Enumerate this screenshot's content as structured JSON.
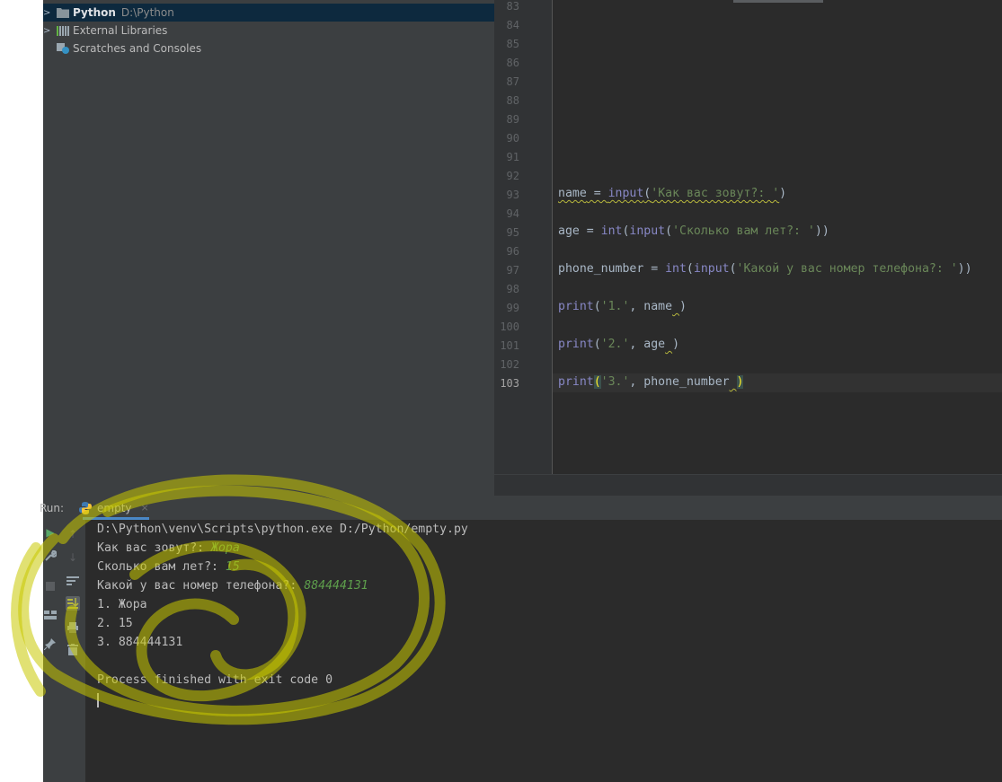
{
  "project_tree": {
    "items": [
      {
        "label": "Python",
        "path": "D:\\Python",
        "selected": true
      },
      {
        "label": "External Libraries"
      },
      {
        "label": "Scratches and Consoles"
      }
    ]
  },
  "editor": {
    "line_numbers": [
      "83",
      "84",
      "85",
      "86",
      "87",
      "88",
      "89",
      "90",
      "91",
      "92",
      "93",
      "94",
      "95",
      "96",
      "97",
      "98",
      "99",
      "100",
      "101",
      "102",
      "103"
    ],
    "current_line": "103",
    "code": {
      "l93": {
        "name": "name",
        "eq": " = ",
        "fn": "input",
        "open": "(",
        "str": "'Как вас зовут?: '",
        "close": ")"
      },
      "l95": {
        "pre": "age = ",
        "fn1": "int",
        "p1": "(",
        "fn2": "input",
        "p2": "(",
        "str": "'Сколько вам лет?: '",
        "close": "))"
      },
      "l97": {
        "pre": "phone_number = ",
        "fn1": "int",
        "p1": "(",
        "fn2": "input",
        "p2": "(",
        "str": "'Какой у вас номер телефона?: '",
        "close": "))"
      },
      "l99": {
        "fn": "print",
        "open": "(",
        "str": "'1.'",
        "mid": ", name",
        "sq": " ",
        "close": ")"
      },
      "l101": {
        "fn": "print",
        "open": "(",
        "str": "'2.'",
        "mid": ", age",
        "sq": " ",
        "close": ")"
      },
      "l103": {
        "fn": "print",
        "open": "(",
        "str": "'3.'",
        "mid": ", phone_number",
        "sq": " ",
        "close": ")"
      }
    }
  },
  "run": {
    "label": "Run:",
    "tab": "empty",
    "close": "×",
    "console": {
      "command": "D:\\Python\\venv\\Scripts\\python.exe D:/Python/empty.py",
      "prompt1": "Как вас зовут?: ",
      "answer1": "Жора",
      "prompt2": "Сколько вам лет?: ",
      "answer2": "15",
      "prompt3": "Какой у вас номер телефона?: ",
      "answer3": "884444131",
      "out1": "1. Жора",
      "out2": "2. 15",
      "out3": "3. 884444131",
      "finish": "Process finished with exit code 0"
    }
  },
  "colors": {
    "scribble": "#c8c800",
    "accent": "#4a88c7"
  }
}
